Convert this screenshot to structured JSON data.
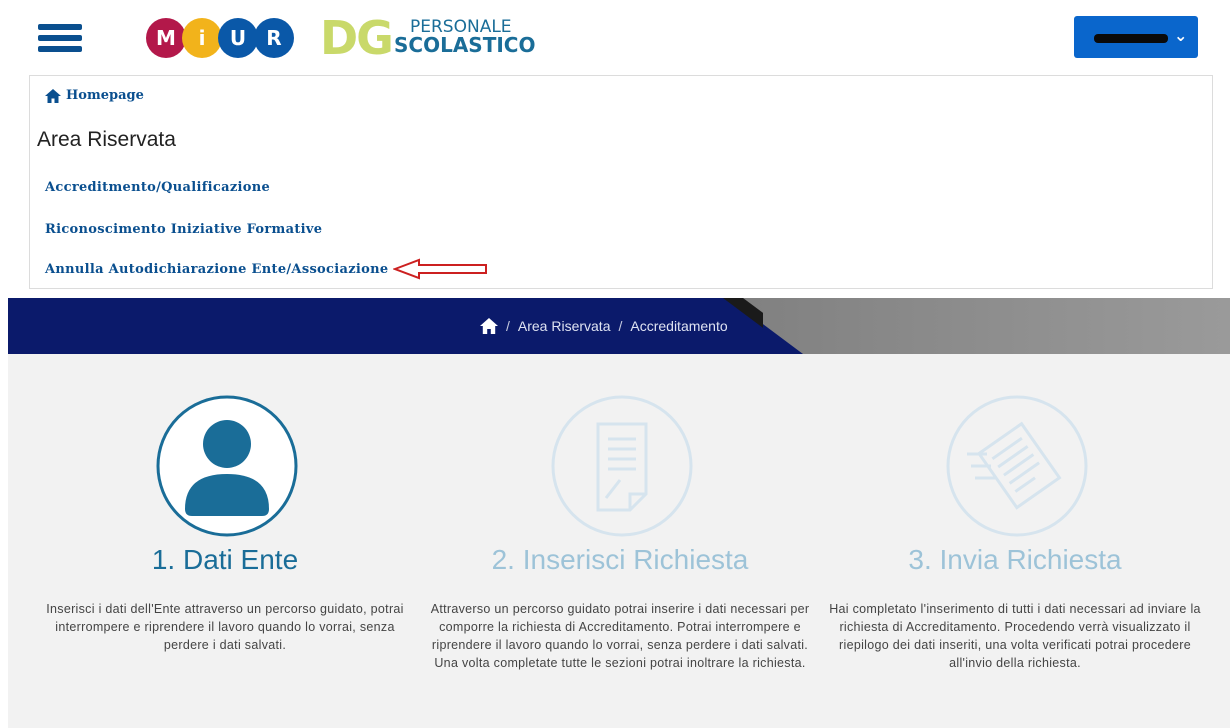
{
  "header": {
    "logo_miur_letters": [
      "M",
      "i",
      "U",
      "R"
    ],
    "logo_dg_letters": "DG",
    "logo_dg_line1": "PERSONALE",
    "logo_dg_line2": "SCOLASTICO"
  },
  "colors": {
    "navy": "#0b1a6b",
    "link_blue": "#0a4f8f",
    "button_blue": "#0a66cc",
    "step_active": "#1a6d98",
    "step_inactive": "#9dc3d8",
    "annotation_red": "#cc2020"
  },
  "panel": {
    "home_link": "Homepage",
    "title": "Area Riservata",
    "links": [
      "Accreditmento/Qualificazione",
      "Riconoscimento Iniziative Formative",
      "Annulla Autodichiarazione Ente/Associazione"
    ]
  },
  "breadcrumb": {
    "items": [
      "Area Riservata",
      "Accreditamento"
    ],
    "separator": "/"
  },
  "steps": [
    {
      "title": "1. Dati Ente",
      "icon": "user-icon",
      "text": "Inserisci i dati dell'Ente attraverso un percorso guidato, potrai interrompere e riprendere il lavoro quando lo vorrai, senza perdere i dati salvati."
    },
    {
      "title": "2. Inserisci Richiesta",
      "icon": "document-edit-icon",
      "text": "Attraverso un percorso guidato potrai inserire i dati necessari per comporre la richiesta di Accreditamento. Potrai interrompere e riprendere il lavoro quando lo vorrai, senza perdere i dati salvati. Una volta completate tutte le sezioni potrai inoltrare la richiesta."
    },
    {
      "title": "3. Invia Richiesta",
      "icon": "send-document-icon",
      "text": "Hai completato l'inserimento di tutti i dati necessari ad inviare la richiesta di Accreditamento. Procedendo verrà visualizzato il riepilogo dei dati inseriti, una volta verificati potrai procedere all'invio della richiesta."
    }
  ]
}
